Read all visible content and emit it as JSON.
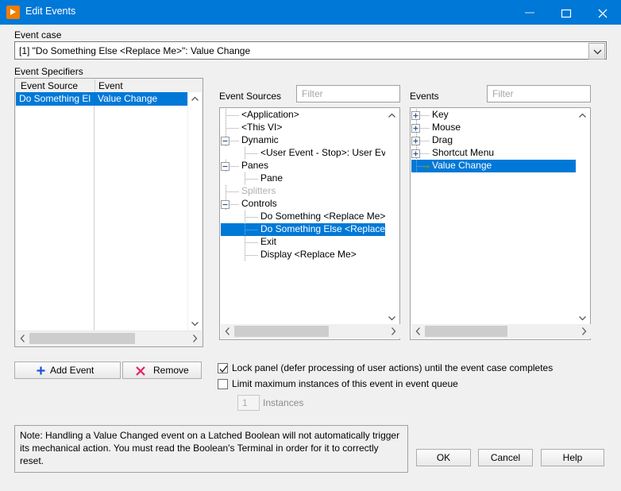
{
  "window": {
    "title": "Edit Events",
    "icon": "labview-run-icon",
    "minimize_label": "minimize-icon",
    "maximize_label": "maximize-icon",
    "close_label": "close-icon",
    "titlebar_color": "#0078d7",
    "accent_color": "#0078d7"
  },
  "event_case": {
    "label": "Event case",
    "value": "[1] \"Do Something Else <Replace Me>\": Value Change"
  },
  "event_specifiers": {
    "label": "Event Specifiers",
    "columns": [
      "Event Source",
      "Event"
    ],
    "rows": [
      {
        "source": "Do Something El",
        "event": "Value Change",
        "selected": true
      }
    ]
  },
  "buttons": {
    "add_event": "Add Event",
    "remove": "Remove",
    "ok": "OK",
    "cancel": "Cancel",
    "help": "Help"
  },
  "event_sources": {
    "label": "Event Sources",
    "filter_placeholder": "Filter",
    "filter_value": "",
    "nodes": [
      {
        "label": "<Application>",
        "depth": 1,
        "toggle": "none",
        "selected": false,
        "dim": false
      },
      {
        "label": "<This VI>",
        "depth": 1,
        "toggle": "none",
        "selected": false,
        "dim": false
      },
      {
        "label": "Dynamic",
        "depth": 1,
        "toggle": "collapse",
        "selected": false,
        "dim": false
      },
      {
        "label": "<User Event - Stop>: User Eve",
        "depth": 2,
        "toggle": "none",
        "selected": false,
        "dim": false
      },
      {
        "label": "Panes",
        "depth": 1,
        "toggle": "collapse",
        "selected": false,
        "dim": false
      },
      {
        "label": "Pane",
        "depth": 2,
        "toggle": "none",
        "selected": false,
        "dim": false
      },
      {
        "label": "Splitters",
        "depth": 1,
        "toggle": "none",
        "selected": false,
        "dim": true
      },
      {
        "label": "Controls",
        "depth": 1,
        "toggle": "collapse",
        "selected": false,
        "dim": false
      },
      {
        "label": "Do Something <Replace Me>",
        "depth": 2,
        "toggle": "none",
        "selected": false,
        "dim": false
      },
      {
        "label": "Do Something Else <Replace",
        "depth": 2,
        "toggle": "none",
        "selected": true,
        "dim": false
      },
      {
        "label": "Exit",
        "depth": 2,
        "toggle": "none",
        "selected": false,
        "dim": false
      },
      {
        "label": "Display <Replace Me>",
        "depth": 2,
        "toggle": "none",
        "selected": false,
        "dim": false
      }
    ]
  },
  "events": {
    "label": "Events",
    "filter_placeholder": "Filter",
    "filter_value": "",
    "nodes": [
      {
        "label": "Key",
        "depth": 1,
        "toggle": "expand",
        "selected": false,
        "arrow": false
      },
      {
        "label": "Mouse",
        "depth": 1,
        "toggle": "expand",
        "selected": false,
        "arrow": false
      },
      {
        "label": "Drag",
        "depth": 1,
        "toggle": "expand",
        "selected": false,
        "arrow": false
      },
      {
        "label": "Shortcut Menu",
        "depth": 1,
        "toggle": "expand",
        "selected": false,
        "arrow": false
      },
      {
        "label": "Value Change",
        "depth": 1,
        "toggle": "none",
        "selected": true,
        "arrow": true
      }
    ]
  },
  "options": {
    "lock_panel": {
      "label": "Lock panel (defer processing of user actions) until the event case completes",
      "checked": true
    },
    "limit_instances": {
      "label": "Limit maximum instances of this event in event queue",
      "checked": false
    },
    "instances": {
      "value": "1",
      "label": "Instances",
      "enabled": false
    }
  },
  "note": {
    "text": "Note:  Handling a Value Changed event on a Latched Boolean will not automatically trigger its mechanical action. You must read the Boolean's Terminal in order for it to correctly reset."
  },
  "scrollbars": {
    "specifiers_h_thumb_pct": 57,
    "sources_h_thumb_pct": 62,
    "events_h_thumb_pct": 54
  }
}
